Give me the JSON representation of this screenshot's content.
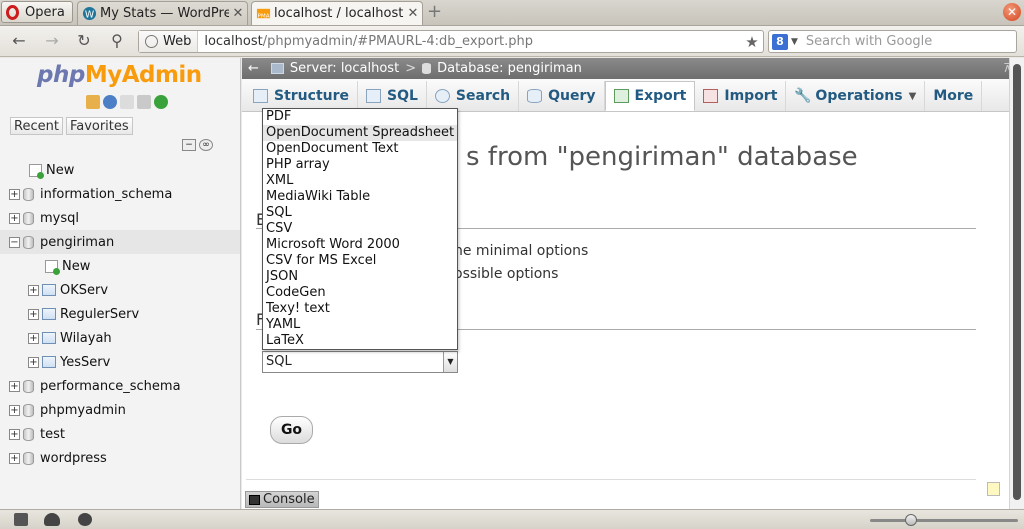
{
  "browser": {
    "menu_label": "Opera",
    "tabs": [
      {
        "title": "My Stats — WordPres...",
        "close": "✕"
      },
      {
        "title": "localhost / localhost / ...",
        "close": "✕"
      }
    ],
    "new_tab": "+",
    "close_window": "✕",
    "web_badge": "Web",
    "url_host": "localhost",
    "url_path": "/phpmyadmin/#PMAURL-4:db_export.php",
    "search_engine_icon": "8",
    "search_placeholder": "Search with Google"
  },
  "pma": {
    "logo_php": "php",
    "logo_myadmin": "MyAdmin",
    "recent_label": "Recent",
    "favorites_label": "Favorites",
    "tree": {
      "new_label": "New",
      "databases": [
        {
          "name": "information_schema"
        },
        {
          "name": "mysql"
        },
        {
          "name": "pengiriman"
        },
        {
          "name": "performance_schema"
        },
        {
          "name": "phpmyadmin"
        },
        {
          "name": "test"
        },
        {
          "name": "wordpress"
        }
      ],
      "pengiriman_new": "New",
      "tables": [
        "OKServ",
        "RegulerServ",
        "Wilayah",
        "YesServ"
      ]
    }
  },
  "main": {
    "breadcrumb_server": "Server: localhost",
    "breadcrumb_sep": ">",
    "breadcrumb_db": "Database: pengiriman",
    "tabs": [
      {
        "label": "Structure"
      },
      {
        "label": "SQL"
      },
      {
        "label": "Search"
      },
      {
        "label": "Query"
      },
      {
        "label": "Export"
      },
      {
        "label": "Import"
      },
      {
        "label": "Operations"
      },
      {
        "label": "More"
      }
    ],
    "heading_left": "E",
    "heading_right": "s from \"pengiriman\" database",
    "section1_label": "E",
    "option1_text": "he minimal options",
    "option2_text": "ossible options",
    "section2_label": "F",
    "format_selected": "SQL",
    "format_options": [
      "PDF",
      "OpenDocument Spreadsheet",
      "OpenDocument Text",
      "PHP array",
      "XML",
      "MediaWiki Table",
      "SQL",
      "CSV",
      "Microsoft Word 2000",
      "CSV for MS Excel",
      "JSON",
      "CodeGen",
      "Texy! text",
      "YAML",
      "LaTeX"
    ],
    "highlighted_option": "OpenDocument Spreadsheet",
    "go_label": "Go",
    "console_label": "Console"
  },
  "colors": {
    "tab_text": "#235a81",
    "breadcrumb_bg": "#7a7a7a",
    "logo_orange": "#f89c0e",
    "logo_purple": "#6c78af"
  },
  "zoom_level_fraction": 0.28
}
